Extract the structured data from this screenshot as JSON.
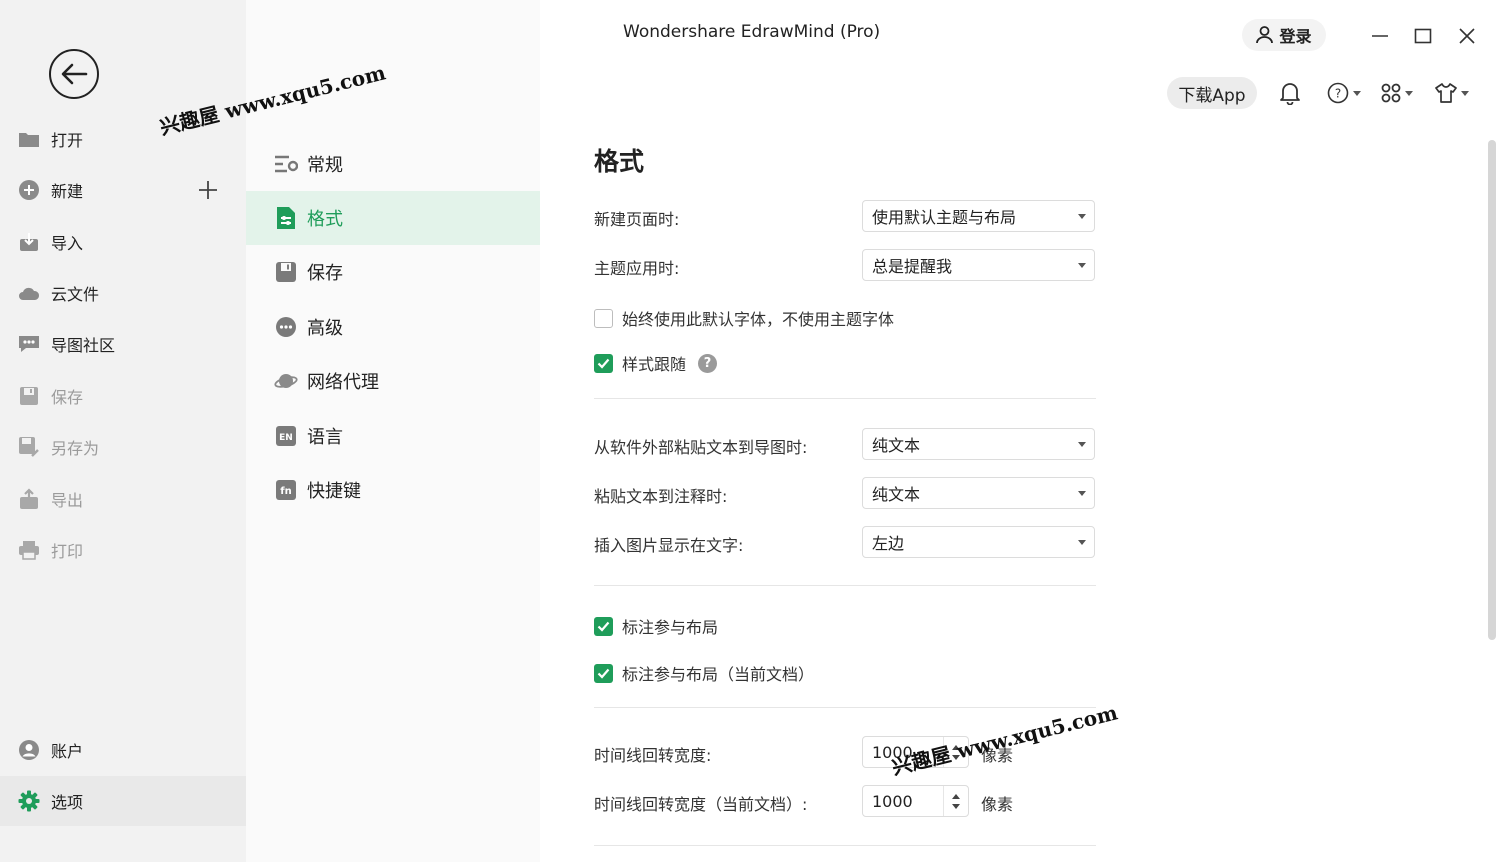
{
  "window": {
    "title": "Wondershare EdrawMind (Pro)",
    "login_label": "登录",
    "download_app_label": "下载App"
  },
  "sidebar": {
    "items": [
      {
        "label": "打开",
        "icon": "folder-icon",
        "enabled": true
      },
      {
        "label": "新建",
        "icon": "plus-circle-icon",
        "enabled": true
      },
      {
        "label": "导入",
        "icon": "import-icon",
        "enabled": true
      },
      {
        "label": "云文件",
        "icon": "cloud-icon",
        "enabled": true
      },
      {
        "label": "导图社区",
        "icon": "community-icon",
        "enabled": true
      },
      {
        "label": "保存",
        "icon": "save-icon",
        "enabled": false
      },
      {
        "label": "另存为",
        "icon": "save-as-icon",
        "enabled": false
      },
      {
        "label": "导出",
        "icon": "export-icon",
        "enabled": false
      },
      {
        "label": "打印",
        "icon": "print-icon",
        "enabled": false
      }
    ],
    "bottom": [
      {
        "label": "账户",
        "icon": "account-icon"
      },
      {
        "label": "选项",
        "icon": "gear-icon",
        "active": true
      }
    ]
  },
  "settings_nav": {
    "items": [
      {
        "label": "常规",
        "icon": "sliders-icon"
      },
      {
        "label": "格式",
        "icon": "format-icon",
        "active": true
      },
      {
        "label": "保存",
        "icon": "save-icon"
      },
      {
        "label": "高级",
        "icon": "more-icon"
      },
      {
        "label": "网络代理",
        "icon": "planet-icon"
      },
      {
        "label": "语言",
        "icon": "en-language-icon"
      },
      {
        "label": "快捷键",
        "icon": "fn-key-icon"
      }
    ]
  },
  "format": {
    "title": "格式",
    "new_page_label": "新建页面时:",
    "new_page_value": "使用默认主题与布局",
    "theme_apply_label": "主题应用时:",
    "theme_apply_value": "总是提醒我",
    "always_default_font_label": "始终使用此默认字体，不使用主题字体",
    "always_default_font_checked": false,
    "style_follow_label": "样式跟随",
    "style_follow_checked": true,
    "help_glyph": "?",
    "paste_external_label": "从软件外部粘贴文本到导图时:",
    "paste_external_value": "纯文本",
    "paste_note_label": "粘贴文本到注释时:",
    "paste_note_value": "纯文本",
    "insert_image_label": "插入图片显示在文字:",
    "insert_image_value": "左边",
    "callout_layout_label": "标注参与布局",
    "callout_layout_checked": true,
    "callout_layout_doc_label": "标注参与布局（当前文档）",
    "callout_layout_doc_checked": true,
    "timeline_width_label": "时间线回转宽度:",
    "timeline_width_value": "1000",
    "timeline_width_unit": "像素",
    "timeline_width_doc_label": "时间线回转宽度（当前文档）:",
    "timeline_width_doc_value": "1000",
    "timeline_width_doc_unit": "像素"
  },
  "watermarks": [
    "兴趣屋 www.xqu5.com",
    "兴趣屋 www.xqu5.com"
  ],
  "colors": {
    "accent": "#1f9d5a",
    "active_nav_bg": "#e3f3ea"
  }
}
